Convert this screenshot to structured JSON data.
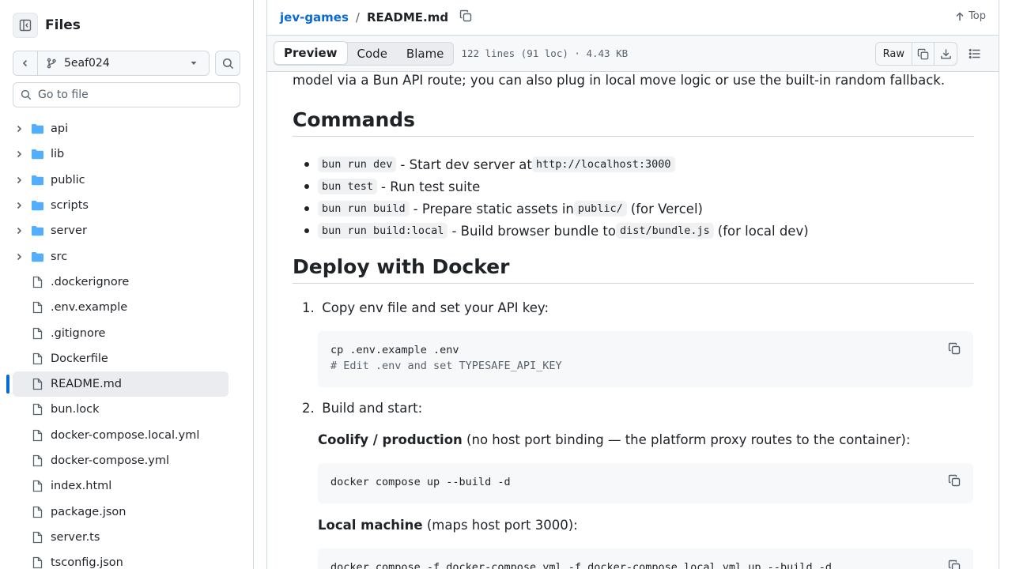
{
  "sidebar": {
    "title": "Files",
    "branch": "5eaf024",
    "goto_placeholder": "Go to file",
    "items": [
      {
        "label": "api",
        "type": "folder"
      },
      {
        "label": "lib",
        "type": "folder"
      },
      {
        "label": "public",
        "type": "folder"
      },
      {
        "label": "scripts",
        "type": "folder"
      },
      {
        "label": "server",
        "type": "folder"
      },
      {
        "label": "src",
        "type": "folder"
      },
      {
        "label": ".dockerignore",
        "type": "file"
      },
      {
        "label": ".env.example",
        "type": "file"
      },
      {
        "label": ".gitignore",
        "type": "file"
      },
      {
        "label": "Dockerfile",
        "type": "file"
      },
      {
        "label": "README.md",
        "type": "file",
        "selected": true
      },
      {
        "label": "bun.lock",
        "type": "file"
      },
      {
        "label": "docker-compose.local.yml",
        "type": "file"
      },
      {
        "label": "docker-compose.yml",
        "type": "file"
      },
      {
        "label": "index.html",
        "type": "file"
      },
      {
        "label": "package.json",
        "type": "file"
      },
      {
        "label": "server.ts",
        "type": "file"
      },
      {
        "label": "tsconfig.json",
        "type": "file"
      }
    ]
  },
  "header": {
    "repo": "jev-games",
    "separator": "/",
    "file": "README.md",
    "top_label": "Top"
  },
  "toolbar": {
    "tabs": [
      "Preview",
      "Code",
      "Blame"
    ],
    "active_tab": "Preview",
    "meta": "122 lines (91 loc) · 4.43 KB",
    "raw_label": "Raw"
  },
  "readme": {
    "cut_line": "model via a Bun API route; you can also plug in local move logic or use the built-in random fallback.",
    "commands_heading": "Commands",
    "commands": [
      {
        "code": "bun run dev",
        "text": "- Start dev server at",
        "code2": "http://localhost:3000",
        "tail": ""
      },
      {
        "code": "bun test",
        "text": "- Run test suite",
        "code2": "",
        "tail": ""
      },
      {
        "code": "bun run build",
        "text": "- Prepare static assets in",
        "code2": "public/",
        "tail": "(for Vercel)"
      },
      {
        "code": "bun run build:local",
        "text": "- Build browser bundle to",
        "code2": "dist/bundle.js",
        "tail": "(for local dev)"
      }
    ],
    "deploy_heading": "Deploy with Docker",
    "step1_num": "1.",
    "step1": "Copy env file and set your API key:",
    "code1_line1": "cp .env.example .env",
    "code1_line2": "# Edit .env and set TYPESAFE_API_KEY",
    "step2_num": "2.",
    "step2": "Build and start:",
    "coolify_bold": "Coolify / production",
    "coolify_rest": "(no host port binding — the platform proxy routes to the container):",
    "code2": "docker compose up --build -d",
    "local_bold": "Local machine",
    "local_rest": "(maps host port 3000):",
    "code3": "docker compose -f docker-compose.yml -f docker-compose.local.yml up --build -d"
  },
  "colors": {
    "accent": "#0969da",
    "folder": "#54aeff",
    "border": "#d1d9e0",
    "muted": "#59636e"
  }
}
